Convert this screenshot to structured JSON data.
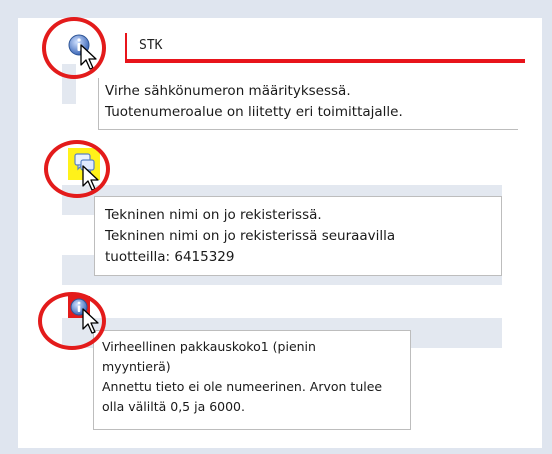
{
  "tooltip1": {
    "header": "STK",
    "lines": [
      "Virhe sähkönumeron määrityksessä.",
      "Tuotenumeroalue on liitetty eri toimittajalle."
    ]
  },
  "tooltip2": {
    "lines": [
      "Tekninen nimi on jo rekisterissä.",
      "Tekninen nimi on jo rekisterissä seuraavilla",
      "tuotteilla: 6415329"
    ]
  },
  "tooltip3": {
    "lines": [
      "Virheellinen pakkauskoko1 (pienin",
      "myyntierä)",
      "Annettu tieto ei ole numeerinen. Arvon tulee",
      "olla väliltä 0,5 ja 6000."
    ]
  },
  "icons": {
    "info1": "info-icon",
    "comment": "comment-icon",
    "info2": "info-icon",
    "cursor": "arrow-cursor-icon"
  },
  "colors": {
    "highlight_red": "#e31b1b",
    "header_line_red": "#e8141b",
    "comment_bg_yellow": "#fff21a",
    "info_blue": "#4a78c8"
  }
}
